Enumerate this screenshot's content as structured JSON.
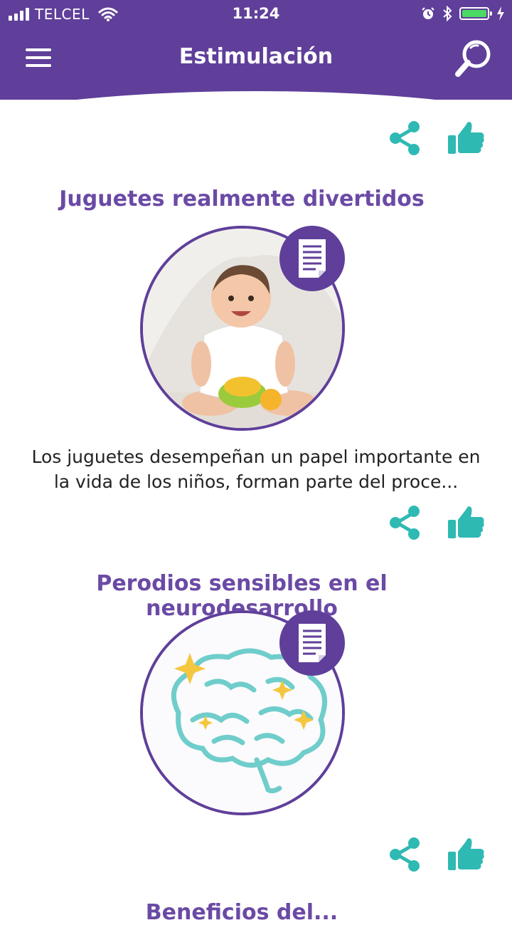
{
  "status_bar": {
    "carrier": "TELCEL",
    "time": "11:24",
    "battery_color": "#4cd964"
  },
  "header": {
    "title": "Estimulación",
    "background": "#5f3f9a",
    "menu_icon": "hamburger-menu-icon",
    "search_icon": "search-icon"
  },
  "cards": [
    {
      "title": "Juguetes realmente divertidos",
      "description": "Los juguetes desempeñan un papel importante en la vida de los niños, forman parte del proce...",
      "badge_icon": "document-icon",
      "image": "baby-with-toy"
    },
    {
      "title": "Perodios sensibles en el neurodesarrollo",
      "description": "",
      "badge_icon": "document-icon",
      "image": "brain-illustration"
    },
    {
      "title": "Beneficios del...",
      "description": ""
    }
  ],
  "actions": {
    "share_icon": "share-icon",
    "like_icon": "thumbs-up-icon",
    "accent": "#2fb9b3"
  }
}
